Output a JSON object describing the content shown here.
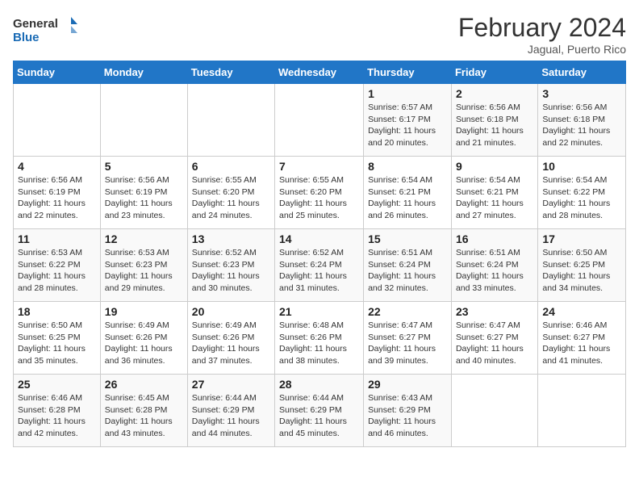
{
  "header": {
    "logo_line1": "General",
    "logo_line2": "Blue",
    "title": "February 2024",
    "subtitle": "Jagual, Puerto Rico"
  },
  "days_of_week": [
    "Sunday",
    "Monday",
    "Tuesday",
    "Wednesday",
    "Thursday",
    "Friday",
    "Saturday"
  ],
  "weeks": [
    [
      {
        "day": "",
        "info": ""
      },
      {
        "day": "",
        "info": ""
      },
      {
        "day": "",
        "info": ""
      },
      {
        "day": "",
        "info": ""
      },
      {
        "day": "1",
        "info": "Sunrise: 6:57 AM\nSunset: 6:17 PM\nDaylight: 11 hours and 20 minutes."
      },
      {
        "day": "2",
        "info": "Sunrise: 6:56 AM\nSunset: 6:18 PM\nDaylight: 11 hours and 21 minutes."
      },
      {
        "day": "3",
        "info": "Sunrise: 6:56 AM\nSunset: 6:18 PM\nDaylight: 11 hours and 22 minutes."
      }
    ],
    [
      {
        "day": "4",
        "info": "Sunrise: 6:56 AM\nSunset: 6:19 PM\nDaylight: 11 hours and 22 minutes."
      },
      {
        "day": "5",
        "info": "Sunrise: 6:56 AM\nSunset: 6:19 PM\nDaylight: 11 hours and 23 minutes."
      },
      {
        "day": "6",
        "info": "Sunrise: 6:55 AM\nSunset: 6:20 PM\nDaylight: 11 hours and 24 minutes."
      },
      {
        "day": "7",
        "info": "Sunrise: 6:55 AM\nSunset: 6:20 PM\nDaylight: 11 hours and 25 minutes."
      },
      {
        "day": "8",
        "info": "Sunrise: 6:54 AM\nSunset: 6:21 PM\nDaylight: 11 hours and 26 minutes."
      },
      {
        "day": "9",
        "info": "Sunrise: 6:54 AM\nSunset: 6:21 PM\nDaylight: 11 hours and 27 minutes."
      },
      {
        "day": "10",
        "info": "Sunrise: 6:54 AM\nSunset: 6:22 PM\nDaylight: 11 hours and 28 minutes."
      }
    ],
    [
      {
        "day": "11",
        "info": "Sunrise: 6:53 AM\nSunset: 6:22 PM\nDaylight: 11 hours and 28 minutes."
      },
      {
        "day": "12",
        "info": "Sunrise: 6:53 AM\nSunset: 6:23 PM\nDaylight: 11 hours and 29 minutes."
      },
      {
        "day": "13",
        "info": "Sunrise: 6:52 AM\nSunset: 6:23 PM\nDaylight: 11 hours and 30 minutes."
      },
      {
        "day": "14",
        "info": "Sunrise: 6:52 AM\nSunset: 6:24 PM\nDaylight: 11 hours and 31 minutes."
      },
      {
        "day": "15",
        "info": "Sunrise: 6:51 AM\nSunset: 6:24 PM\nDaylight: 11 hours and 32 minutes."
      },
      {
        "day": "16",
        "info": "Sunrise: 6:51 AM\nSunset: 6:24 PM\nDaylight: 11 hours and 33 minutes."
      },
      {
        "day": "17",
        "info": "Sunrise: 6:50 AM\nSunset: 6:25 PM\nDaylight: 11 hours and 34 minutes."
      }
    ],
    [
      {
        "day": "18",
        "info": "Sunrise: 6:50 AM\nSunset: 6:25 PM\nDaylight: 11 hours and 35 minutes."
      },
      {
        "day": "19",
        "info": "Sunrise: 6:49 AM\nSunset: 6:26 PM\nDaylight: 11 hours and 36 minutes."
      },
      {
        "day": "20",
        "info": "Sunrise: 6:49 AM\nSunset: 6:26 PM\nDaylight: 11 hours and 37 minutes."
      },
      {
        "day": "21",
        "info": "Sunrise: 6:48 AM\nSunset: 6:26 PM\nDaylight: 11 hours and 38 minutes."
      },
      {
        "day": "22",
        "info": "Sunrise: 6:47 AM\nSunset: 6:27 PM\nDaylight: 11 hours and 39 minutes."
      },
      {
        "day": "23",
        "info": "Sunrise: 6:47 AM\nSunset: 6:27 PM\nDaylight: 11 hours and 40 minutes."
      },
      {
        "day": "24",
        "info": "Sunrise: 6:46 AM\nSunset: 6:27 PM\nDaylight: 11 hours and 41 minutes."
      }
    ],
    [
      {
        "day": "25",
        "info": "Sunrise: 6:46 AM\nSunset: 6:28 PM\nDaylight: 11 hours and 42 minutes."
      },
      {
        "day": "26",
        "info": "Sunrise: 6:45 AM\nSunset: 6:28 PM\nDaylight: 11 hours and 43 minutes."
      },
      {
        "day": "27",
        "info": "Sunrise: 6:44 AM\nSunset: 6:29 PM\nDaylight: 11 hours and 44 minutes."
      },
      {
        "day": "28",
        "info": "Sunrise: 6:44 AM\nSunset: 6:29 PM\nDaylight: 11 hours and 45 minutes."
      },
      {
        "day": "29",
        "info": "Sunrise: 6:43 AM\nSunset: 6:29 PM\nDaylight: 11 hours and 46 minutes."
      },
      {
        "day": "",
        "info": ""
      },
      {
        "day": "",
        "info": ""
      }
    ]
  ]
}
